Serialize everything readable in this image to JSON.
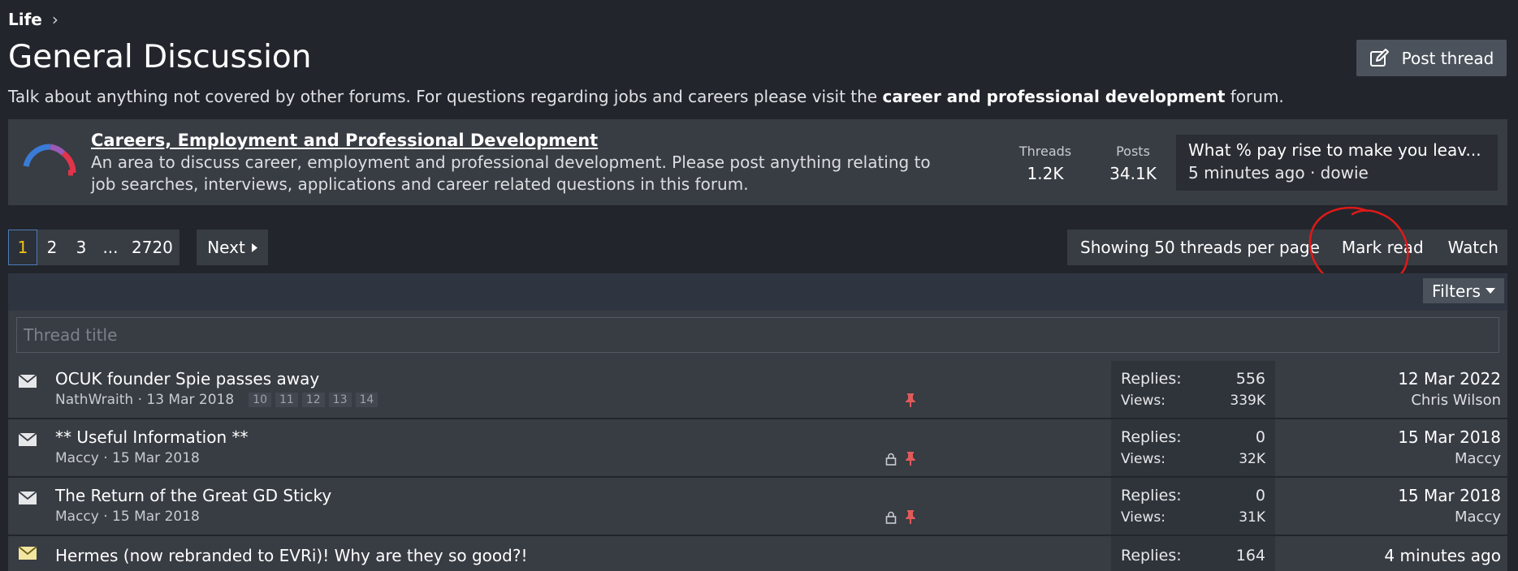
{
  "breadcrumb": {
    "item": "Life"
  },
  "page": {
    "title": "General Discussion",
    "description_pre": "Talk about anything not covered by other forums. For questions regarding jobs and careers please visit the ",
    "description_link": "career and professional development",
    "description_post": " forum."
  },
  "header": {
    "post_thread_label": "Post thread"
  },
  "subforum": {
    "title": "Careers, Employment and Professional Development",
    "description": "An area to discuss career, employment and professional development. Please post anything relating to job searches, interviews, applications and career related questions in this forum.",
    "threads_label": "Threads",
    "threads_value": "1.2K",
    "posts_label": "Posts",
    "posts_value": "34.1K",
    "latest_title": "What % pay rise to make you leav...",
    "latest_meta": "5 minutes ago · dowie"
  },
  "pagination": {
    "pages": [
      "1",
      "2",
      "3",
      "...",
      "2720"
    ],
    "current": "1",
    "next_label": "Next"
  },
  "actions": {
    "showing": "Showing 50 threads per page",
    "mark_read": "Mark read",
    "watch": "Watch"
  },
  "filters": {
    "label": "Filters"
  },
  "search": {
    "placeholder": "Thread title"
  },
  "threads": [
    {
      "title": "OCUK founder Spie passes away",
      "meta": "NathWraith · 13 Mar 2018",
      "pages": [
        "10",
        "11",
        "12",
        "13",
        "14"
      ],
      "replies_label": "Replies:",
      "replies": "556",
      "views_label": "Views:",
      "views": "339K",
      "last_date": "12 Mar 2022",
      "last_user": "Chris Wilson"
    },
    {
      "title": "** Useful Information **",
      "meta": "Maccy · 15 Mar 2018",
      "replies_label": "Replies:",
      "replies": "0",
      "views_label": "Views:",
      "views": "32K",
      "last_date": "15 Mar 2018",
      "last_user": "Maccy"
    },
    {
      "title": "The Return of the Great GD Sticky",
      "meta": "Maccy · 15 Mar 2018",
      "replies_label": "Replies:",
      "replies": "0",
      "views_label": "Views:",
      "views": "31K",
      "last_date": "15 Mar 2018",
      "last_user": "Maccy"
    },
    {
      "title": "Hermes (now rebranded to EVRi)! Why are they so good?!",
      "replies_label": "Replies:",
      "replies": "164",
      "last_date": "4 minutes ago"
    }
  ],
  "colors": {
    "background": "#22262c",
    "panel": "#383c43",
    "current_page": "#f0c419",
    "pin": "#e05a5a",
    "annotation": "#e01919"
  },
  "icons": [
    "chevron-right-icon",
    "edit-icon",
    "gauge-icon",
    "caret-right-icon",
    "caret-down-icon",
    "envelope-icon",
    "envelope-unread-icon",
    "lock-icon",
    "pin-icon"
  ]
}
